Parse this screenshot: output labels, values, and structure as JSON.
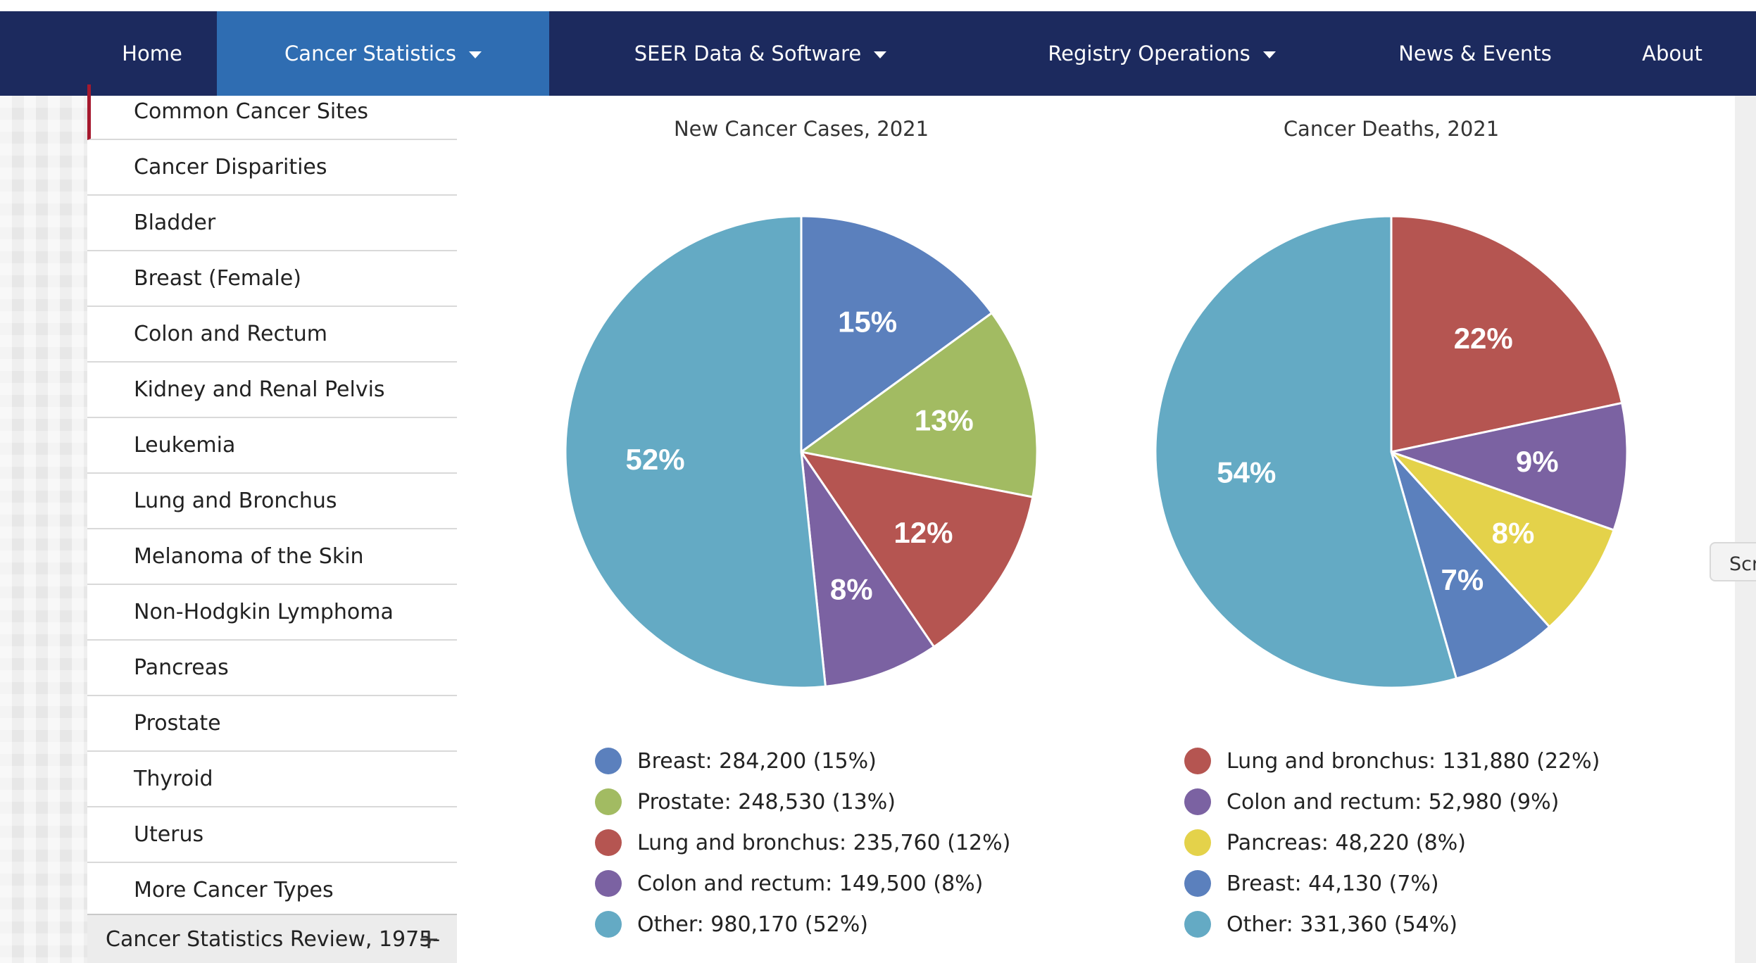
{
  "nav": {
    "items": [
      {
        "label": "Home",
        "active": false,
        "dropdown": false
      },
      {
        "label": "Cancer Statistics",
        "active": true,
        "dropdown": true
      },
      {
        "label": "SEER Data & Software",
        "active": false,
        "dropdown": true
      },
      {
        "label": "Registry Operations",
        "active": false,
        "dropdown": true
      },
      {
        "label": "News & Events",
        "active": false,
        "dropdown": false
      },
      {
        "label": "About",
        "active": false,
        "dropdown": false
      }
    ]
  },
  "sidebar": {
    "items": [
      {
        "label": "Common Cancer Sites",
        "current": true
      },
      {
        "label": "Cancer Disparities"
      },
      {
        "label": "Bladder"
      },
      {
        "label": "Breast (Female)"
      },
      {
        "label": "Colon and Rectum"
      },
      {
        "label": "Kidney and Renal Pelvis"
      },
      {
        "label": "Leukemia"
      },
      {
        "label": "Lung and Bronchus"
      },
      {
        "label": "Melanoma of the Skin"
      },
      {
        "label": "Non-Hodgkin Lymphoma"
      },
      {
        "label": "Pancreas"
      },
      {
        "label": "Prostate"
      },
      {
        "label": "Thyroid"
      },
      {
        "label": "Uterus"
      },
      {
        "label": "More Cancer Types"
      }
    ],
    "review": {
      "label": "Cancer Statistics Review, 1975-",
      "toggle": "+"
    }
  },
  "scroll_tab_label": "Scr",
  "chart_data": [
    {
      "type": "pie",
      "title": "New Cancer Cases, 2021",
      "slices": [
        {
          "label": "Breast",
          "value": 284200,
          "percent_label": "15%",
          "legend": "Breast: 284,200 (15%)",
          "color": "#5b80bd"
        },
        {
          "label": "Prostate",
          "value": 248530,
          "percent_label": "13%",
          "legend": "Prostate: 248,530 (13%)",
          "color": "#a2bb62"
        },
        {
          "label": "Lung and bronchus",
          "value": 235760,
          "percent_label": "12%",
          "legend": "Lung and bronchus: 235,760 (12%)",
          "color": "#b55551"
        },
        {
          "label": "Colon and rectum",
          "value": 149500,
          "percent_label": "8%",
          "legend": "Colon and rectum: 149,500 (8%)",
          "color": "#7b62a2"
        },
        {
          "label": "Other",
          "value": 980170,
          "percent_label": "52%",
          "legend": "Other: 980,170 (52%)",
          "color": "#64aac4"
        }
      ]
    },
    {
      "type": "pie",
      "title": "Cancer Deaths, 2021",
      "slices": [
        {
          "label": "Lung and bronchus",
          "value": 131880,
          "percent_label": "22%",
          "legend": "Lung and bronchus: 131,880 (22%)",
          "color": "#b55551"
        },
        {
          "label": "Colon and rectum",
          "value": 52980,
          "percent_label": "9%",
          "legend": "Colon and rectum: 52,980 (9%)",
          "color": "#7b62a2"
        },
        {
          "label": "Pancreas",
          "value": 48220,
          "percent_label": "8%",
          "legend": "Pancreas: 48,220 (8%)",
          "color": "#e4d24a"
        },
        {
          "label": "Breast",
          "value": 44130,
          "percent_label": "7%",
          "legend": "Breast: 44,130 (7%)",
          "color": "#5b80bd"
        },
        {
          "label": "Other",
          "value": 331360,
          "percent_label": "54%",
          "legend": "Other: 331,360 (54%)",
          "color": "#64aac4"
        }
      ]
    }
  ]
}
